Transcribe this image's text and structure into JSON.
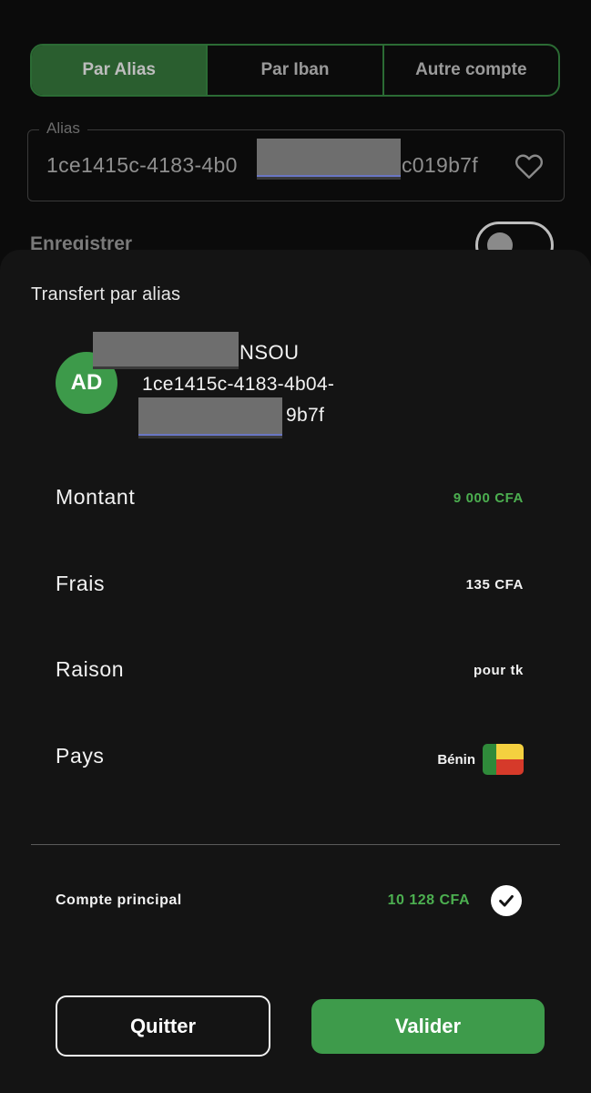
{
  "tabs": [
    {
      "label": "Par Alias",
      "active": true
    },
    {
      "label": "Par Iban",
      "active": false
    },
    {
      "label": "Autre compte",
      "active": false
    }
  ],
  "alias_field": {
    "label": "Alias",
    "value_start": "1ce1415c-4183-4b0",
    "value_end": "c019b7f"
  },
  "save_label": "Enregistrer",
  "sheet": {
    "title": "Transfert par alias",
    "recipient": {
      "initials": "AD",
      "name_visible": "NSOU",
      "id_line1": "1ce1415c-4183-4b04-",
      "id_line2_visible": "9b7f"
    },
    "rows": [
      {
        "label": "Montant",
        "value": "9 000 CFA"
      },
      {
        "label": "Frais",
        "value": "135 CFA"
      },
      {
        "label": "Raison",
        "value": "pour tk"
      },
      {
        "label": "Pays",
        "value": "Bénin"
      }
    ],
    "account": {
      "label": "Compte principal",
      "balance": "10 128 CFA"
    },
    "buttons": {
      "quit": "Quitter",
      "validate": "Valider"
    }
  },
  "colors": {
    "accent_green": "#4caf50",
    "button_green": "#3e9b4b",
    "sheet_bg": "#141414"
  },
  "icons": [
    "heart-icon",
    "check-icon",
    "benin-flag-icon"
  ]
}
